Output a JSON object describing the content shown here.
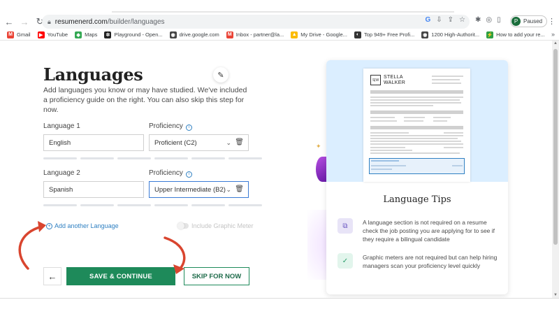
{
  "browser": {
    "url_domain": "resumenerd.com",
    "url_path": "/builder/languages",
    "profile_initial": "P",
    "profile_status": "Paused",
    "bookmarks": [
      {
        "label": "Gmail",
        "color": "#ea4335",
        "glyph": "M"
      },
      {
        "label": "YouTube",
        "color": "#ff0000",
        "glyph": "▶"
      },
      {
        "label": "Maps",
        "color": "#34a853",
        "glyph": "◆"
      },
      {
        "label": "Playground - Open...",
        "color": "#222222",
        "glyph": "✲"
      },
      {
        "label": "drive.google.com",
        "color": "#444444",
        "glyph": "◉"
      },
      {
        "label": "Inbox - partner@la...",
        "color": "#ea4335",
        "glyph": "M"
      },
      {
        "label": "My Drive - Google...",
        "color": "#fbbc04",
        "glyph": "▲"
      },
      {
        "label": "Top 949+ Free Profi...",
        "color": "#333333",
        "glyph": "◐"
      },
      {
        "label": "1200 High-Authorit...",
        "color": "#444444",
        "glyph": "◉"
      },
      {
        "label": "How to add your re...",
        "color": "#2ea043",
        "glyph": "⚡"
      }
    ]
  },
  "main": {
    "title": "Languages",
    "subtitle": "Add languages you know or may have studied. We've included a proficiency guide on the right. You can also skip this step for now.",
    "languages": [
      {
        "label": "Language 1",
        "value": "English",
        "proficiency_label": "Proficiency",
        "proficiency": "Proficient (C2)"
      },
      {
        "label": "Language 2",
        "value": "Spanish",
        "proficiency_label": "Proficiency",
        "proficiency": "Upper Intermediate (B2)"
      }
    ],
    "add_language": "Add another Language",
    "graphic_meter_toggle": "Include Graphic Meter",
    "save_label": "SAVE & CONTINUE",
    "skip_label": "SKIP FOR NOW"
  },
  "tips": {
    "resume_monogram": "S|W",
    "resume_first": "STELLA",
    "resume_last": "WALKER",
    "title": "Language Tips",
    "items": [
      {
        "icon": "chat-bubbles-icon",
        "bg": "#e8e4f7",
        "color": "#6a56c2",
        "text": "A language section is not required on a resume check the job posting you are applying for to see if they require a bilingual candidate"
      },
      {
        "icon": "check-icon",
        "bg": "#e2f5ec",
        "color": "#2a9d6a",
        "text": "Graphic meters are not required but can help hiring managers scan your proficiency level quickly"
      }
    ]
  },
  "colors": {
    "primary_green": "#1e8a5a",
    "link_blue": "#2f80c2",
    "annotation_red": "#d9452f"
  }
}
